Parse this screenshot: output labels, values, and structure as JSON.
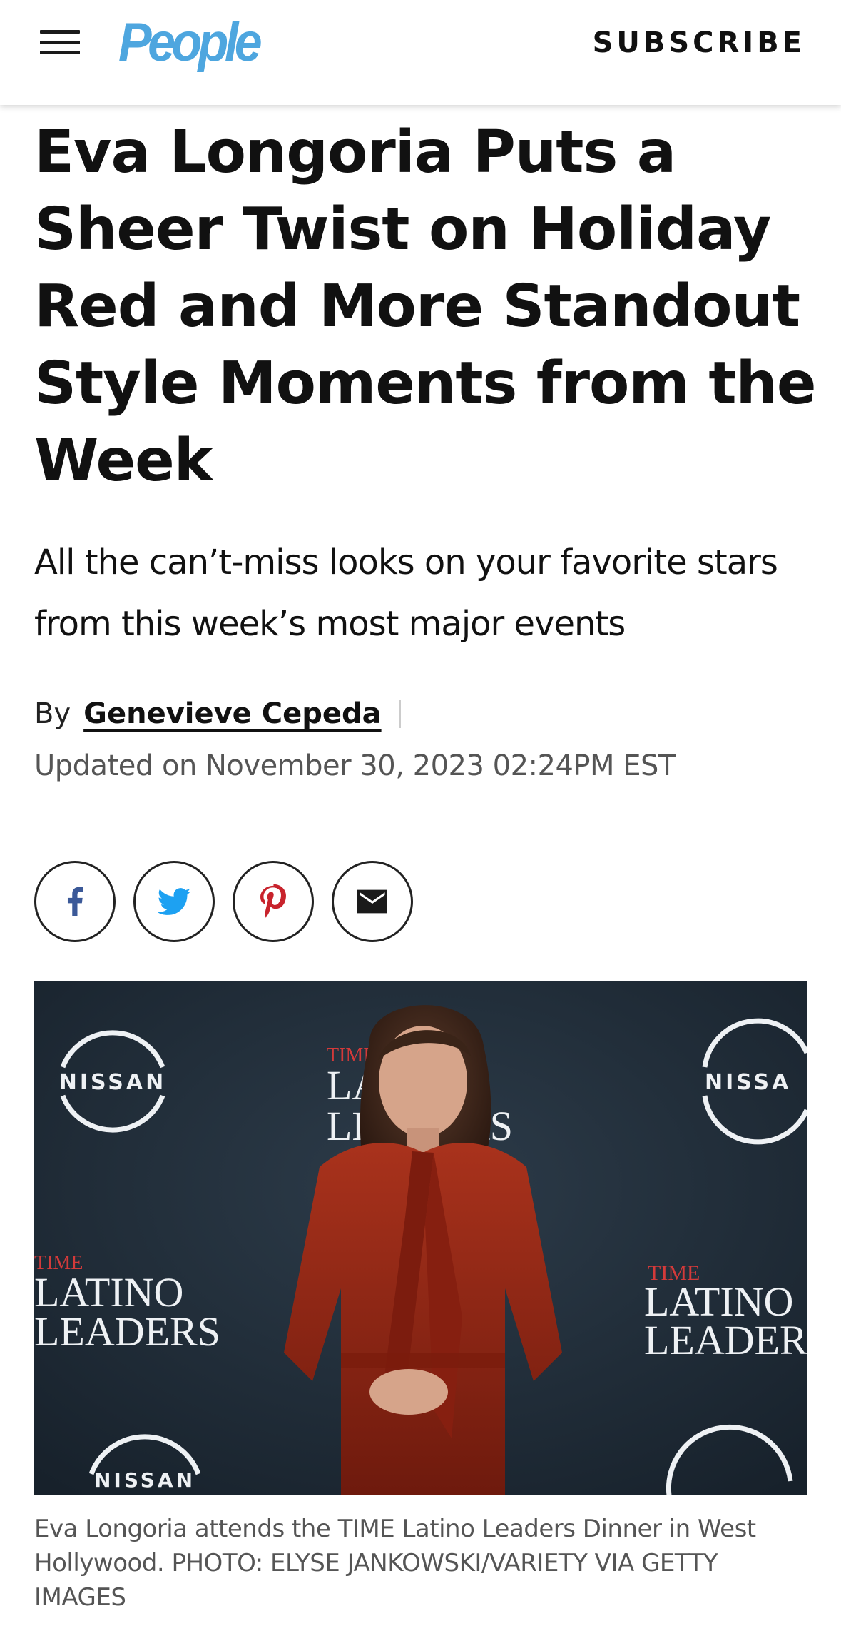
{
  "header": {
    "logo": "People",
    "subscribe_label": "SUBSCRIBE"
  },
  "article": {
    "title": "Eva Longoria Puts a Sheer Twist on Holiday Red and More Standout Style Moments from the Week",
    "dek": "All the can’t-miss looks on your favorite stars from this week’s most major events",
    "byline_prefix": "By",
    "author": "Genevieve Cepeda",
    "updated": "Updated on November 30, 2023 02:24PM EST"
  },
  "share": {
    "icons": [
      "facebook-icon",
      "twitter-icon",
      "pinterest-icon",
      "email-icon"
    ]
  },
  "hero": {
    "backdrop": {
      "nissan": "NISSAN",
      "nissan_cut": "NISSA",
      "time": "TIME",
      "latino": "LATINO",
      "leaders": "LEADERS",
      "latino_cut": "LATINO",
      "leaders_cut": "LEADERS"
    },
    "caption": "Eva Longoria attends the TIME Latino Leaders Dinner in West Hollywood. PHOTO: ELYSE JANKOWSKI/VARIETY VIA GETTY IMAGES"
  },
  "colors": {
    "brand": "#4ea6df",
    "facebook": "#3b5998",
    "twitter": "#1da1f2",
    "pinterest": "#c8232c",
    "backdrop": "#1f2c38",
    "dress": "#8f2512"
  }
}
